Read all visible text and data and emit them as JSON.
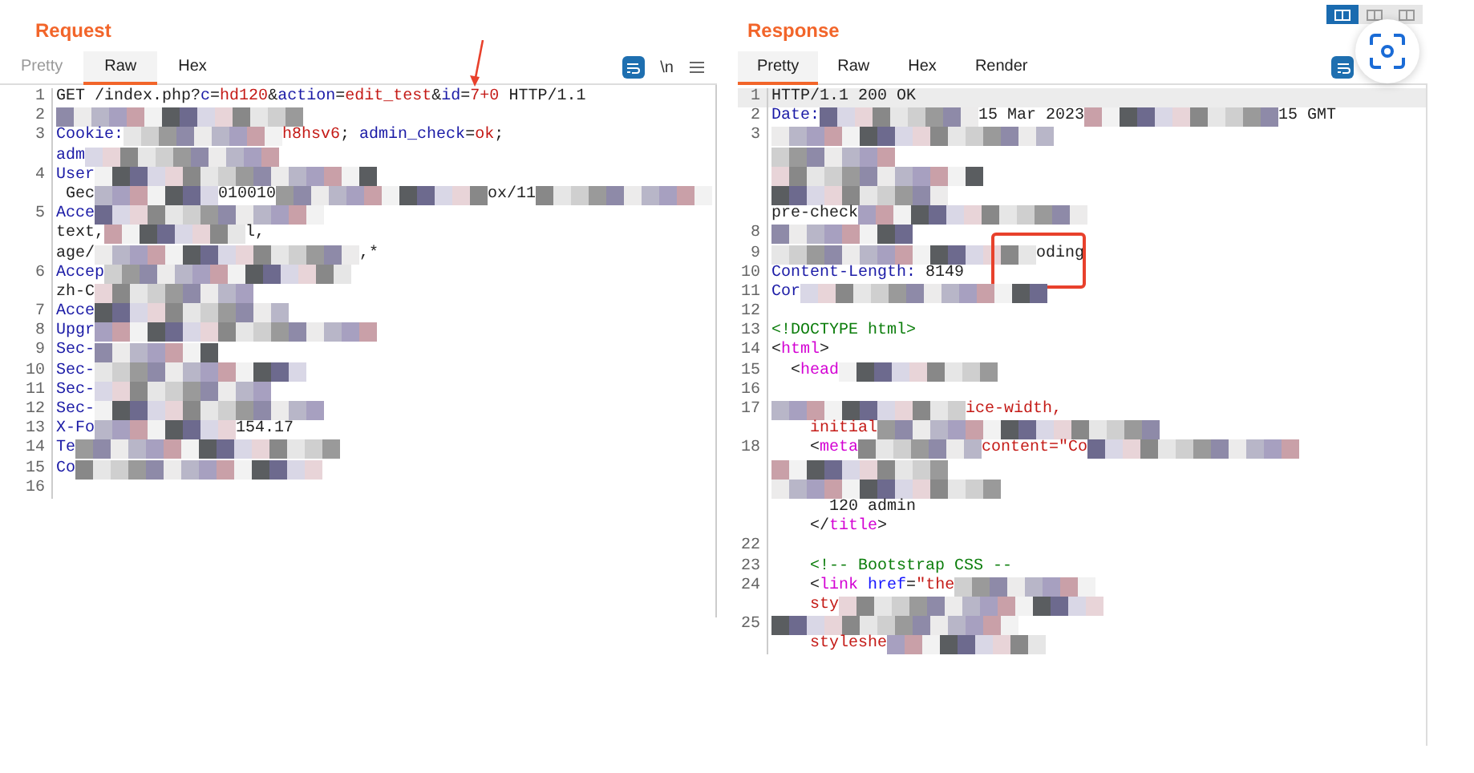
{
  "layout_buttons": [
    {
      "selected": true
    },
    {
      "selected": false
    },
    {
      "selected": false
    }
  ],
  "request": {
    "title": "Request",
    "tabs": [
      {
        "label": "Pretty",
        "selected": false,
        "disabled": true
      },
      {
        "label": "Raw",
        "selected": true,
        "disabled": false
      },
      {
        "label": "Hex",
        "selected": false,
        "disabled": false
      }
    ],
    "newline_toggle": "\\n",
    "lines": [
      {
        "num": "1",
        "parts": [
          {
            "kind": "plain",
            "text": "GET /index.php?"
          },
          {
            "kind": "key",
            "text": "c"
          },
          {
            "kind": "plain",
            "text": "="
          },
          {
            "kind": "value",
            "text": "hd120"
          },
          {
            "kind": "plain",
            "text": "&"
          },
          {
            "kind": "key",
            "text": "action"
          },
          {
            "kind": "plain",
            "text": "="
          },
          {
            "kind": "value",
            "text": "edit_test"
          },
          {
            "kind": "plain",
            "text": "&"
          },
          {
            "kind": "key",
            "text": "id"
          },
          {
            "kind": "plain",
            "text": "="
          },
          {
            "kind": "value",
            "text": "7+0",
            "marked": true
          },
          {
            "kind": "plain",
            "text": " HTTP/1.1"
          }
        ]
      },
      {
        "num": "2",
        "parts": [
          {
            "kind": "redacted"
          }
        ]
      },
      {
        "num": "3",
        "parts": [
          {
            "kind": "key",
            "text": "Cookie:"
          },
          {
            "kind": "redacted"
          },
          {
            "kind": "value",
            "text": "h8hsv6"
          },
          {
            "kind": "plain",
            "text": "; "
          },
          {
            "kind": "key",
            "text": "admin_check"
          },
          {
            "kind": "plain",
            "text": "="
          },
          {
            "kind": "value",
            "text": "ok"
          },
          {
            "kind": "plain",
            "text": ";"
          }
        ]
      },
      {
        "parts": [
          {
            "kind": "key",
            "text": "adm"
          },
          {
            "kind": "redacted"
          }
        ]
      },
      {
        "num": "4",
        "parts": [
          {
            "kind": "key",
            "text": "User"
          },
          {
            "kind": "redacted"
          }
        ]
      },
      {
        "parts": [
          {
            "kind": "plain",
            "text": " Gec"
          },
          {
            "kind": "redacted"
          },
          {
            "kind": "plain",
            "text": "010010"
          },
          {
            "kind": "redacted"
          },
          {
            "kind": "plain",
            "text": "ox/11"
          },
          {
            "kind": "redacted"
          }
        ]
      },
      {
        "num": "5",
        "parts": [
          {
            "kind": "key",
            "text": "Acce"
          },
          {
            "kind": "redacted"
          }
        ]
      },
      {
        "parts": [
          {
            "kind": "plain",
            "text": "text,"
          },
          {
            "kind": "redacted"
          },
          {
            "kind": "plain",
            "text": "l,"
          }
        ]
      },
      {
        "parts": [
          {
            "kind": "plain",
            "text": "age/"
          },
          {
            "kind": "redacted"
          },
          {
            "kind": "plain",
            "text": ",*"
          }
        ]
      },
      {
        "num": "6",
        "parts": [
          {
            "kind": "key",
            "text": "Accep"
          },
          {
            "kind": "redacted"
          }
        ]
      },
      {
        "parts": [
          {
            "kind": "plain",
            "text": "zh-C"
          },
          {
            "kind": "redacted"
          }
        ]
      },
      {
        "num": "7",
        "parts": [
          {
            "kind": "key",
            "text": "Acce"
          },
          {
            "kind": "redacted"
          }
        ]
      },
      {
        "num": "8",
        "parts": [
          {
            "kind": "key",
            "text": "Upgr"
          },
          {
            "kind": "redacted"
          }
        ]
      },
      {
        "num": "9",
        "parts": [
          {
            "kind": "key",
            "text": "Sec-"
          },
          {
            "kind": "redacted"
          }
        ]
      },
      {
        "num": "10",
        "parts": [
          {
            "kind": "key",
            "text": "Sec-"
          },
          {
            "kind": "redacted"
          }
        ]
      },
      {
        "num": "11",
        "parts": [
          {
            "kind": "key",
            "text": "Sec-"
          },
          {
            "kind": "redacted"
          }
        ]
      },
      {
        "num": "12",
        "parts": [
          {
            "kind": "key",
            "text": "Sec-"
          },
          {
            "kind": "redacted"
          }
        ]
      },
      {
        "num": "13",
        "parts": [
          {
            "kind": "key",
            "text": "X-Fo"
          },
          {
            "kind": "redacted"
          },
          {
            "kind": "plain",
            "text": "154.17"
          }
        ]
      },
      {
        "num": "14",
        "parts": [
          {
            "kind": "key",
            "text": "Te"
          },
          {
            "kind": "redacted"
          }
        ]
      },
      {
        "num": "15",
        "parts": [
          {
            "kind": "key",
            "text": "Co"
          },
          {
            "kind": "redacted"
          }
        ]
      },
      {
        "num": "16"
      }
    ]
  },
  "response": {
    "title": "Response",
    "tabs": [
      {
        "label": "Pretty",
        "selected": true,
        "disabled": false
      },
      {
        "label": "Raw",
        "selected": false,
        "disabled": false
      },
      {
        "label": "Hex",
        "selected": false,
        "disabled": false
      },
      {
        "label": "Render",
        "selected": false,
        "disabled": false
      }
    ],
    "lines": [
      {
        "num": "1",
        "highlighted": true,
        "parts": [
          {
            "kind": "plain",
            "text": "HTTP/1.1 200 OK"
          }
        ]
      },
      {
        "num": "2",
        "parts": [
          {
            "kind": "key",
            "text": "Date:"
          },
          {
            "kind": "redacted"
          },
          {
            "kind": "plain",
            "text": "15 Mar 2023"
          },
          {
            "kind": "redacted"
          },
          {
            "kind": "plain",
            "text": "15 GMT"
          }
        ]
      },
      {
        "num": "3",
        "parts": [
          {
            "kind": "redacted"
          }
        ]
      },
      {
        "parts": [
          {
            "kind": "redacted"
          }
        ]
      },
      {
        "parts": [
          {
            "kind": "redacted"
          }
        ]
      },
      {
        "parts": [
          {
            "kind": "redacted"
          }
        ]
      },
      {
        "parts": [
          {
            "kind": "plain",
            "text": "pre-check"
          },
          {
            "kind": "redacted"
          }
        ]
      },
      {
        "num": "8",
        "boxed": true,
        "parts": [
          {
            "kind": "redacted"
          }
        ]
      },
      {
        "num": "9",
        "boxed": true,
        "parts": [
          {
            "kind": "redacted"
          },
          {
            "kind": "plain",
            "text": "oding"
          }
        ]
      },
      {
        "num": "10",
        "boxed": true,
        "parts": [
          {
            "kind": "key",
            "text": "Content-Length:"
          },
          {
            "kind": "plain",
            "text": " 8149"
          }
        ]
      },
      {
        "num": "11",
        "parts": [
          {
            "kind": "key",
            "text": "Cor"
          },
          {
            "kind": "redacted"
          }
        ]
      },
      {
        "num": "12"
      },
      {
        "num": "13",
        "parts": [
          {
            "kind": "comment",
            "text": "<!DOCTYPE html>"
          }
        ]
      },
      {
        "num": "14",
        "parts": [
          {
            "kind": "plain",
            "text": "<"
          },
          {
            "kind": "tag",
            "text": "html"
          },
          {
            "kind": "plain",
            "text": ">"
          }
        ]
      },
      {
        "num": "15",
        "parts": [
          {
            "kind": "plain",
            "text": "  <"
          },
          {
            "kind": "tag",
            "text": "head"
          },
          {
            "kind": "redacted"
          }
        ]
      },
      {
        "num": "16"
      },
      {
        "num": "17",
        "parts": [
          {
            "kind": "redacted"
          },
          {
            "kind": "value",
            "text": "ice-width,"
          }
        ]
      },
      {
        "parts": [
          {
            "kind": "value",
            "text": "    initial"
          },
          {
            "kind": "redacted"
          }
        ]
      },
      {
        "num": "18",
        "parts": [
          {
            "kind": "plain",
            "text": "    <"
          },
          {
            "kind": "tag",
            "text": "meta"
          },
          {
            "kind": "redacted"
          },
          {
            "kind": "value",
            "text": "content=\"Co"
          },
          {
            "kind": "redacted"
          }
        ]
      },
      {
        "parts": [
          {
            "kind": "redacted"
          }
        ]
      },
      {
        "parts": [
          {
            "kind": "redacted"
          }
        ]
      },
      {
        "parts": [
          {
            "kind": "plain",
            "text": "      120 admin"
          }
        ]
      },
      {
        "parts": [
          {
            "kind": "plain",
            "text": "    </"
          },
          {
            "kind": "tag",
            "text": "title"
          },
          {
            "kind": "plain",
            "text": ">"
          }
        ]
      },
      {
        "num": "22"
      },
      {
        "num": "23",
        "parts": [
          {
            "kind": "comment",
            "text": "    <!-- Bootstrap CSS --"
          }
        ]
      },
      {
        "num": "24",
        "parts": [
          {
            "kind": "plain",
            "text": "    <"
          },
          {
            "kind": "tag",
            "text": "link"
          },
          {
            "kind": "attr",
            "text": " href"
          },
          {
            "kind": "plain",
            "text": "="
          },
          {
            "kind": "value",
            "text": "\"the"
          },
          {
            "kind": "redacted"
          }
        ]
      },
      {
        "parts": [
          {
            "kind": "value",
            "text": "    sty"
          },
          {
            "kind": "redacted"
          }
        ]
      },
      {
        "num": "25",
        "parts": [
          {
            "kind": "redacted"
          }
        ]
      },
      {
        "parts": [
          {
            "kind": "value",
            "text": "    styleshe"
          },
          {
            "kind": "redacted"
          }
        ]
      }
    ]
  }
}
